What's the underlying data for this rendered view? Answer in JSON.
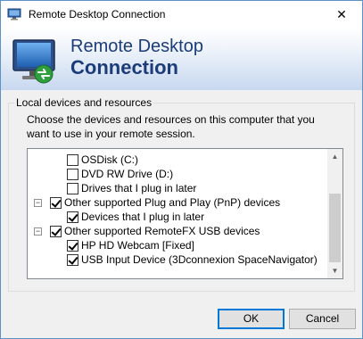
{
  "window": {
    "title": "Remote Desktop Connection",
    "close_glyph": "✕"
  },
  "banner": {
    "line1": "Remote Desktop",
    "line2": "Connection",
    "logo_icon": "remote-desktop-monitor-icon"
  },
  "group": {
    "label": "Local devices and resources",
    "description": "Choose the devices and resources on this computer that you want to use in your remote session."
  },
  "tree": {
    "rows": [
      {
        "label": "OSDisk (C:)",
        "checked": false,
        "expander": "",
        "level": 2
      },
      {
        "label": "DVD RW Drive (D:)",
        "checked": false,
        "expander": "",
        "level": 2
      },
      {
        "label": "Drives that I plug in later",
        "checked": false,
        "expander": "",
        "level": 2
      },
      {
        "label": "Other supported Plug and Play (PnP) devices",
        "checked": true,
        "expander": "−",
        "level": 1
      },
      {
        "label": "Devices that I plug in later",
        "checked": true,
        "expander": "",
        "level": 2
      },
      {
        "label": "Other supported RemoteFX USB devices",
        "checked": true,
        "expander": "−",
        "level": 1
      },
      {
        "label": "HP HD Webcam [Fixed]",
        "checked": true,
        "expander": "",
        "level": 2
      },
      {
        "label": "USB Input Device (3Dconnexion SpaceNavigator)",
        "checked": true,
        "expander": "",
        "level": 2
      }
    ],
    "scroll_up_glyph": "▲",
    "scroll_down_glyph": "▼"
  },
  "buttons": {
    "ok": "OK",
    "cancel": "Cancel"
  },
  "colors": {
    "banner_text": "#1b3c78",
    "accent": "#0078d7"
  }
}
